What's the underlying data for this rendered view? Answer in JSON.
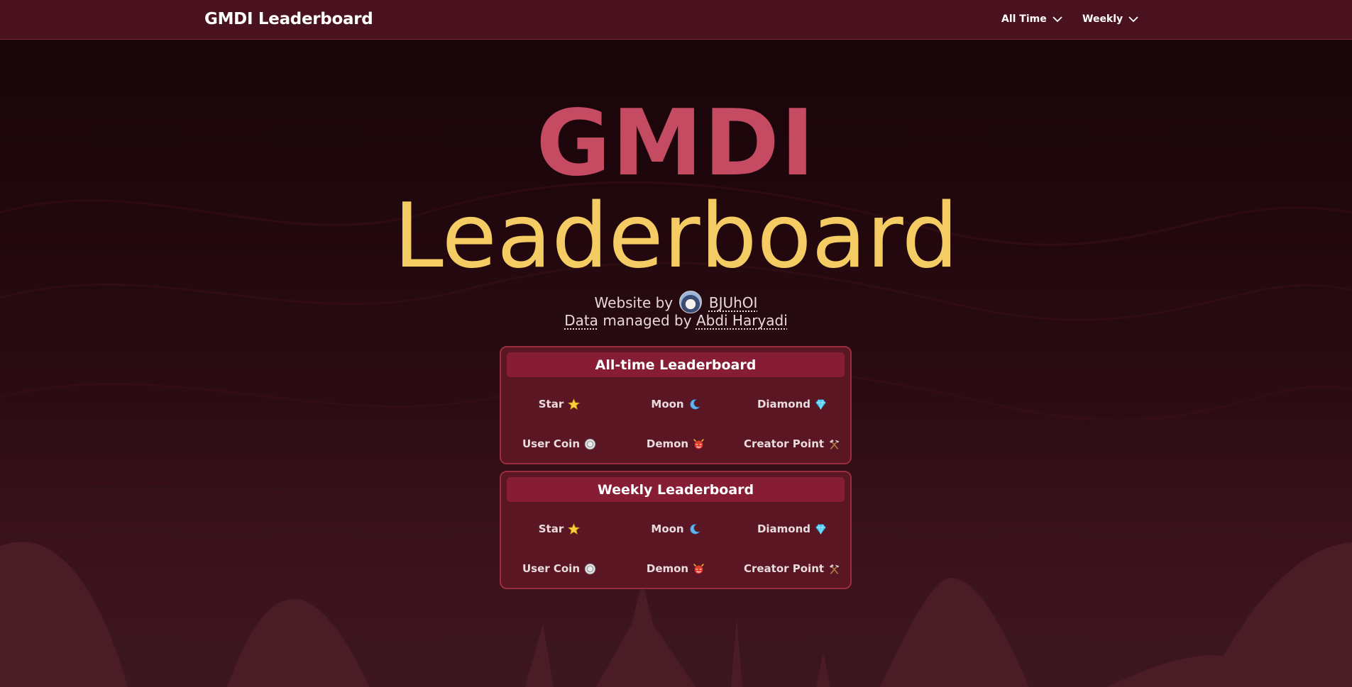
{
  "nav": {
    "brand": "GMDI Leaderboard",
    "dropdowns": [
      {
        "label": "All Time"
      },
      {
        "label": "Weekly"
      }
    ]
  },
  "hero": {
    "line1": "GMDI",
    "line2": "Leaderboard"
  },
  "credits": {
    "website_prefix": "Website by",
    "website_author": "BJUhOI",
    "data_link": "Data",
    "data_middle": "managed by",
    "data_manager": "Abdi Haryadi"
  },
  "boards": [
    {
      "title": "All-time Leaderboard",
      "items": [
        {
          "label": "Star",
          "icon": "star-icon"
        },
        {
          "label": "Moon",
          "icon": "moon-icon"
        },
        {
          "label": "Diamond",
          "icon": "diamond-icon"
        },
        {
          "label": "User Coin",
          "icon": "user-coin-icon"
        },
        {
          "label": "Demon",
          "icon": "demon-icon"
        },
        {
          "label": "Creator Point",
          "icon": "hammer-pick-icon"
        }
      ]
    },
    {
      "title": "Weekly Leaderboard",
      "items": [
        {
          "label": "Star",
          "icon": "star-icon"
        },
        {
          "label": "Moon",
          "icon": "moon-icon"
        },
        {
          "label": "Diamond",
          "icon": "diamond-icon"
        },
        {
          "label": "User Coin",
          "icon": "user-coin-icon"
        },
        {
          "label": "Demon",
          "icon": "demon-icon"
        },
        {
          "label": "Creator Point",
          "icon": "hammer-pick-icon"
        }
      ]
    }
  ],
  "colors": {
    "navbar": "#4a121f",
    "accent_red": "#c44b62",
    "accent_gold": "#f5cc63",
    "panel": "#5a1623",
    "panel_header": "#861d34"
  }
}
